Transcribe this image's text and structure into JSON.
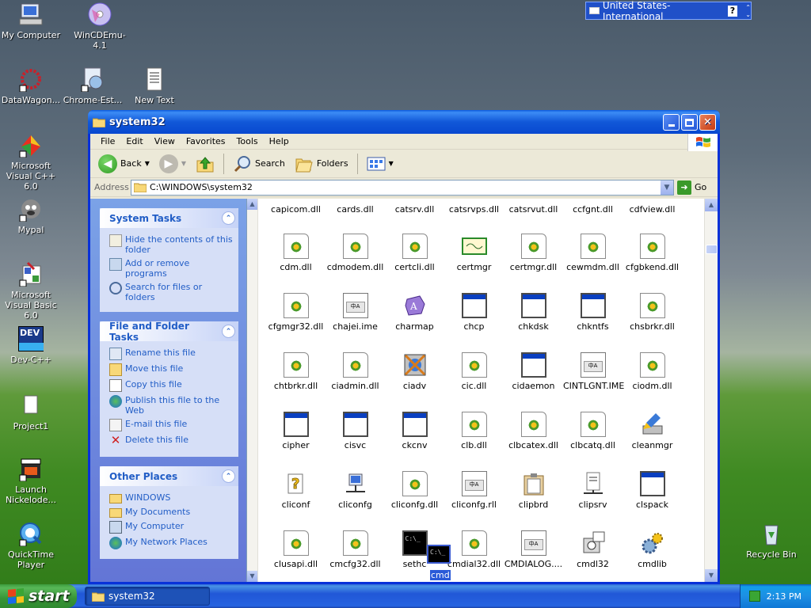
{
  "desktop": {
    "icons": [
      {
        "label": "My Computer"
      },
      {
        "label": "WinCDEmu-4.1"
      },
      {
        "label": "DataWagon..."
      },
      {
        "label": "Chrome-Est..."
      },
      {
        "label": "New Text"
      },
      {
        "label": "Microsoft Visual C++ 6.0"
      },
      {
        "label": "Mypal"
      },
      {
        "label": "Microsoft Visual Basic 6.0"
      },
      {
        "label": "Dev-C++"
      },
      {
        "label": "Project1"
      },
      {
        "label": "Launch Nickelode..."
      },
      {
        "label": "QuickTime Player"
      },
      {
        "label": "Recycle Bin"
      }
    ],
    "dev_badge": "DEV"
  },
  "language_bar": {
    "label": "United States-International",
    "help": "?"
  },
  "window": {
    "title": "system32",
    "menu": [
      "File",
      "Edit",
      "View",
      "Favorites",
      "Tools",
      "Help"
    ],
    "toolbar": {
      "back": "Back",
      "search": "Search",
      "folders": "Folders"
    },
    "address": {
      "label": "Address",
      "value": "C:\\WINDOWS\\system32",
      "go": "Go"
    },
    "system_tasks": {
      "title": "System Tasks",
      "items": [
        "Hide the contents of this folder",
        "Add or remove programs",
        "Search for files or folders"
      ]
    },
    "file_tasks": {
      "title": "File and Folder Tasks",
      "items": [
        "Rename this file",
        "Move this file",
        "Copy this file",
        "Publish this file to the Web",
        "E-mail this file",
        "Delete this file"
      ]
    },
    "other_places": {
      "title": "Other Places",
      "items": [
        "WINDOWS",
        "My Documents",
        "My Computer",
        "My Network Places"
      ]
    },
    "top_row_names": [
      "capicom.dll",
      "cards.dll",
      "catsrv.dll",
      "catsrvps.dll",
      "catsrvut.dll",
      "ccfgnt.dll",
      "cdfview.dll"
    ],
    "files": [
      [
        {
          "name": "cdm.dll",
          "type": "dll"
        },
        {
          "name": "cdmodem.dll",
          "type": "dll"
        },
        {
          "name": "certcli.dll",
          "type": "dll"
        },
        {
          "name": "certmgr",
          "type": "cert"
        },
        {
          "name": "certmgr.dll",
          "type": "dll"
        },
        {
          "name": "cewmdm.dll",
          "type": "dll"
        },
        {
          "name": "cfgbkend.dll",
          "type": "dll"
        }
      ],
      [
        {
          "name": "cfgmgr32.dll",
          "type": "dll"
        },
        {
          "name": "chajei.ime",
          "type": "ime"
        },
        {
          "name": "charmap",
          "type": "charmap"
        },
        {
          "name": "chcp",
          "type": "exe"
        },
        {
          "name": "chkdsk",
          "type": "exe"
        },
        {
          "name": "chkntfs",
          "type": "exe"
        },
        {
          "name": "chsbrkr.dll",
          "type": "dll"
        }
      ],
      [
        {
          "name": "chtbrkr.dll",
          "type": "dll"
        },
        {
          "name": "ciadmin.dll",
          "type": "dll"
        },
        {
          "name": "ciadv",
          "type": "ciadv"
        },
        {
          "name": "cic.dll",
          "type": "dll"
        },
        {
          "name": "cidaemon",
          "type": "exe"
        },
        {
          "name": "CINTLGNT.IME",
          "type": "ime"
        },
        {
          "name": "ciodm.dll",
          "type": "dll"
        }
      ],
      [
        {
          "name": "cipher",
          "type": "exe"
        },
        {
          "name": "cisvc",
          "type": "exe"
        },
        {
          "name": "ckcnv",
          "type": "exe"
        },
        {
          "name": "clb.dll",
          "type": "dll"
        },
        {
          "name": "clbcatex.dll",
          "type": "dll"
        },
        {
          "name": "clbcatq.dll",
          "type": "dll"
        },
        {
          "name": "cleanmgr",
          "type": "cleanmgr"
        }
      ],
      [
        {
          "name": "cliconf",
          "type": "help"
        },
        {
          "name": "cliconfg",
          "type": "net"
        },
        {
          "name": "cliconfg.dll",
          "type": "dll"
        },
        {
          "name": "cliconfg.rll",
          "type": "ime"
        },
        {
          "name": "clipbrd",
          "type": "clipbrd"
        },
        {
          "name": "clipsrv",
          "type": "clipsrv"
        },
        {
          "name": "clspack",
          "type": "exe"
        }
      ],
      [
        {
          "name": "clusapi.dll",
          "type": "dll"
        },
        {
          "name": "cmcfg32.dll",
          "type": "dll"
        },
        {
          "name": "sethc",
          "type": "cmd"
        },
        {
          "name": "cmdial32.dll",
          "type": "dll"
        },
        {
          "name": "CMDIALOG....",
          "type": "ime"
        },
        {
          "name": "cmdl32",
          "type": "cmdl"
        },
        {
          "name": "cmdlib",
          "type": "gear"
        }
      ]
    ],
    "drag_label": "cmd"
  },
  "taskbar": {
    "start": "start",
    "task_item": "system32",
    "clock": "2:13 PM"
  },
  "colors": {
    "task_link": "#215dc6",
    "titlebar": "#0a5ae0",
    "start_green": "#3c9b3c"
  }
}
